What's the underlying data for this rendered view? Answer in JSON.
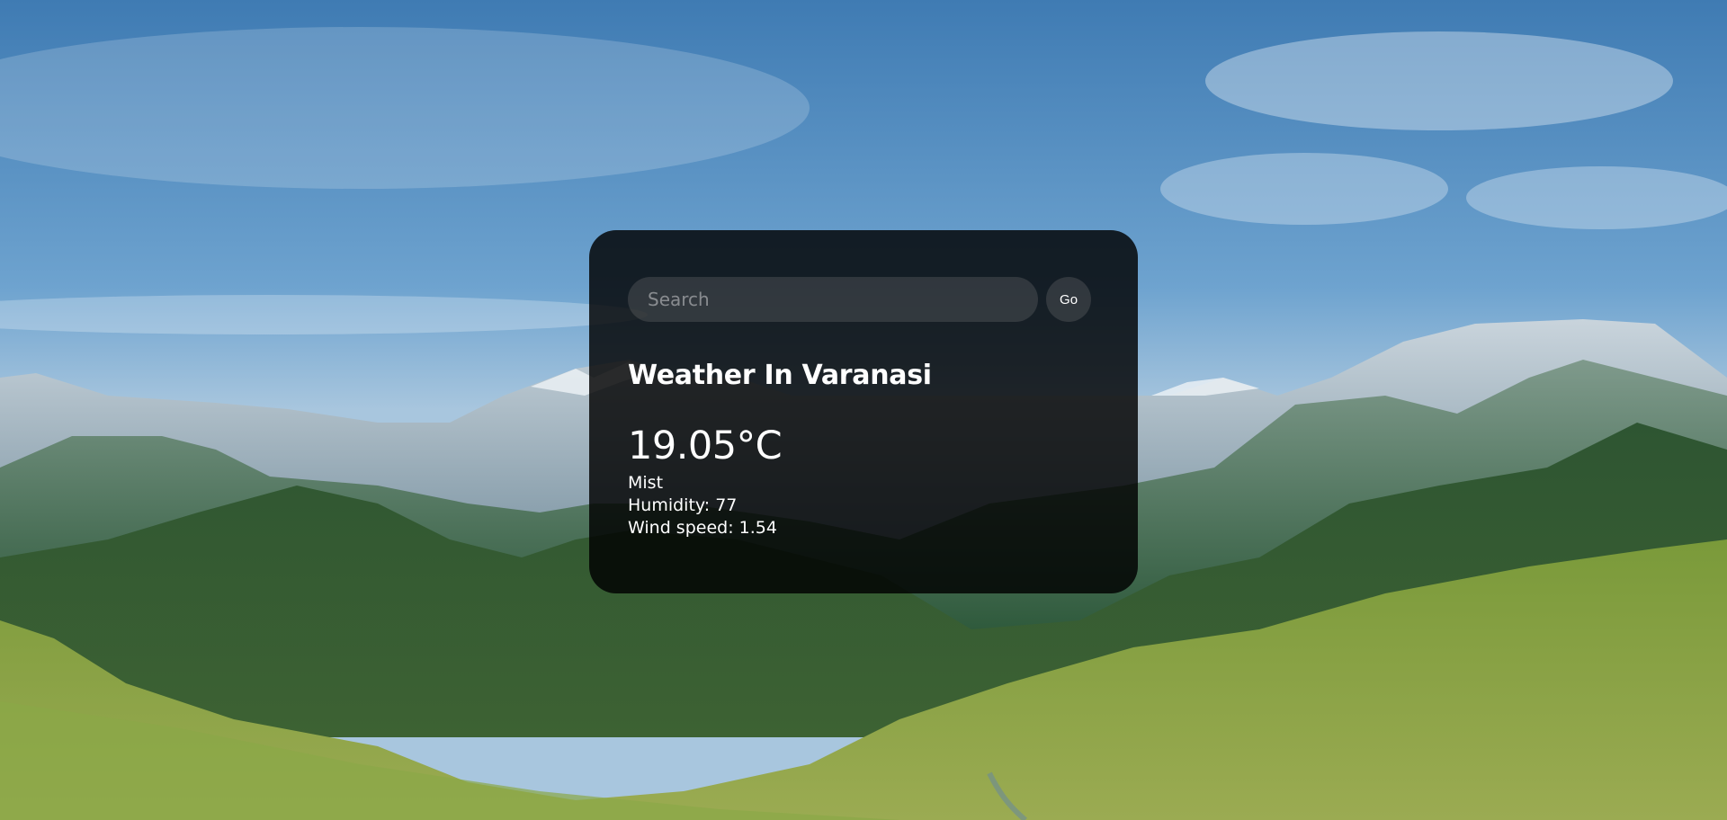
{
  "search": {
    "placeholder": "Search",
    "button_label": "Go"
  },
  "weather": {
    "title": "Weather In Varanasi",
    "temperature": "19.05°C",
    "description": "Mist",
    "humidity": "Humidity: 77",
    "wind": "Wind speed: 1.54"
  },
  "colors": {
    "card_background": "#000000",
    "text": "#ffffff",
    "sky": "#6ea0cb",
    "mountains": "#4f7a6a",
    "meadow": "#7ea23e"
  },
  "icons": {
    "background": "mountain-landscape-photo"
  }
}
